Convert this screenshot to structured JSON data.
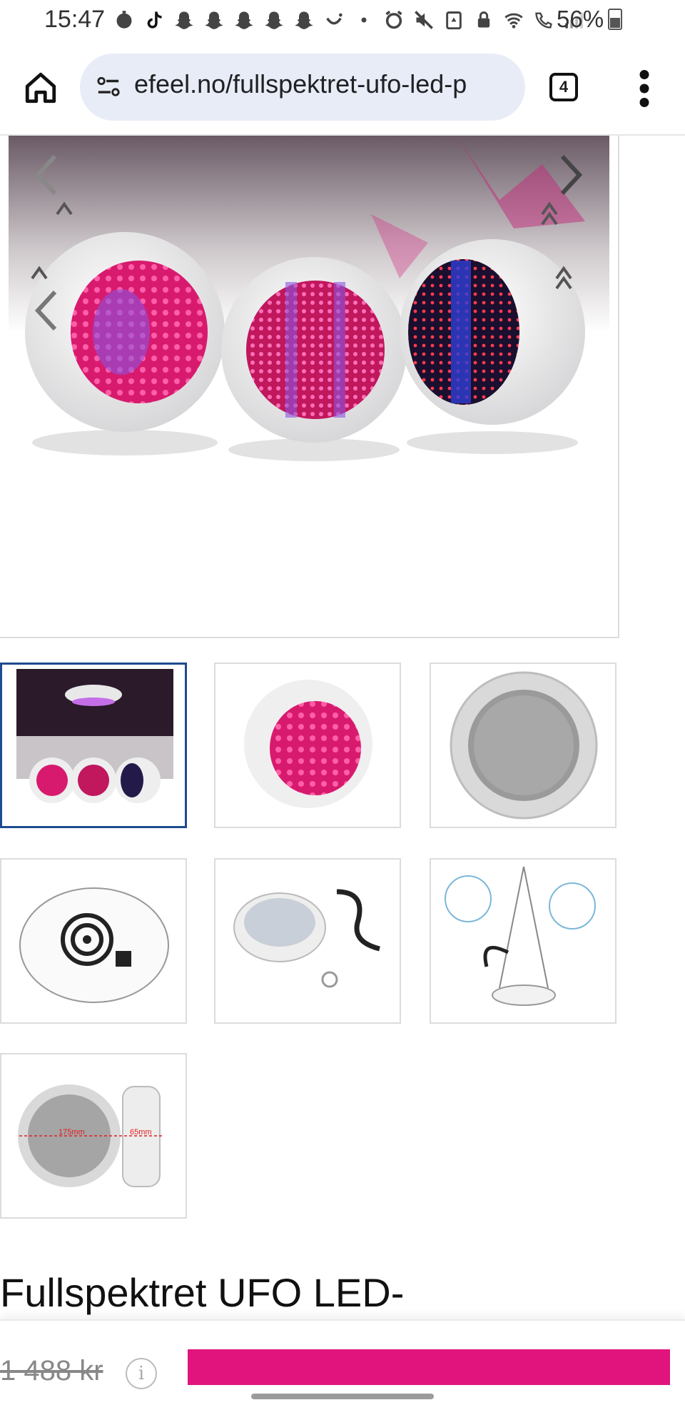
{
  "status_bar": {
    "time": "15:47",
    "battery": "56%",
    "icons": [
      "timer-icon",
      "tiktok-icon",
      "snapchat-icon",
      "snapchat-icon",
      "snapchat-icon",
      "snapchat-icon",
      "snapchat-icon",
      "smile-icon",
      "dot-icon",
      "alarm-icon",
      "mute-icon",
      "recycle-icon",
      "lock-icon",
      "wifi-icon",
      "wifi-call-icon",
      "signal-icon"
    ]
  },
  "browser": {
    "url": "efeel.no/fullspektret-ufo-led-p",
    "tab_count": "4",
    "icons": {
      "home": "home-icon",
      "site_info": "site-settings-icon",
      "menu": "more-vert-icon"
    }
  },
  "gallery": {
    "main_image": "three-ufo-led-grow-lights-photo",
    "prev": "chevron-left-icon",
    "next": "chevron-right-icon",
    "thumbnails": [
      {
        "name": "thumb-lights-hanging-set",
        "active": true
      },
      {
        "name": "thumb-single-light-angle",
        "active": false
      },
      {
        "name": "thumb-light-front-off",
        "active": false
      },
      {
        "name": "thumb-light-back-fan",
        "active": false
      },
      {
        "name": "thumb-light-with-cable",
        "active": false
      },
      {
        "name": "thumb-hanging-kit",
        "active": false
      },
      {
        "name": "thumb-dimensions",
        "active": false
      }
    ],
    "dimension_labels": [
      "175mm",
      "65mm"
    ]
  },
  "product": {
    "title": "Fullspektret UFO LED-",
    "old_price": "1 488 kr",
    "info_glyph": "i"
  },
  "colors": {
    "accent": "#e0147c",
    "active_border": "#1e4b8f"
  }
}
